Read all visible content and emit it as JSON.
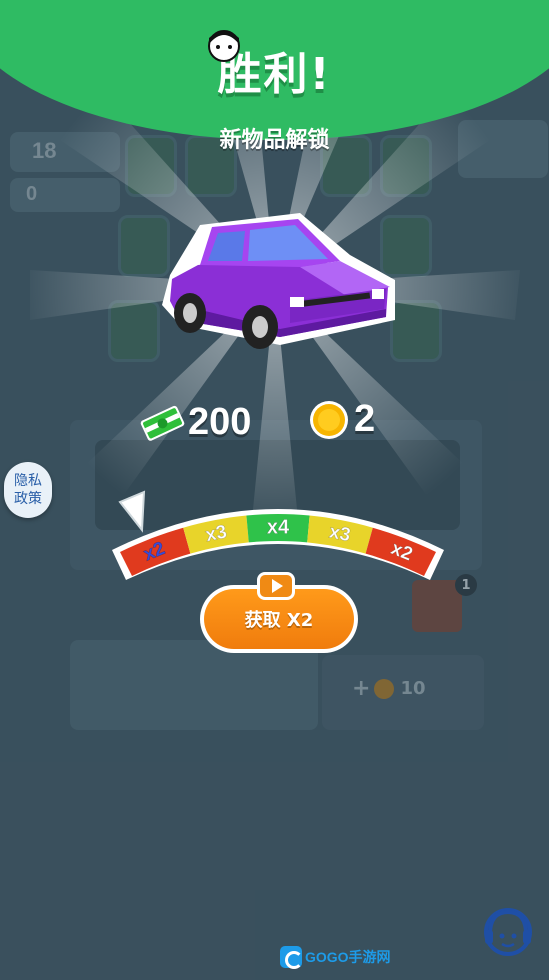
{
  "header": {
    "title": "胜利!",
    "subtitle": "新物品解锁"
  },
  "rewards": {
    "cash": "200",
    "coins": "2"
  },
  "multiplier": {
    "segments": [
      "x2",
      "x3",
      "x4",
      "x3",
      "x2"
    ],
    "segment_colors": [
      "#e03a1e",
      "#e8d42a",
      "#2fc24a",
      "#e8d42a",
      "#e03a1e"
    ],
    "selected": "x2"
  },
  "claim_button": {
    "label": "获取 X2"
  },
  "privacy_button": {
    "label": "隐私政策"
  },
  "background": {
    "count_18": "18",
    "count_0": "0",
    "bottom_cost": "10",
    "badge_count": "1"
  },
  "watermark": {
    "text": "GOGO手游网"
  },
  "colors": {
    "banner": "#2fbb63",
    "car": "#8b2fd6",
    "button": "#f58a14"
  }
}
